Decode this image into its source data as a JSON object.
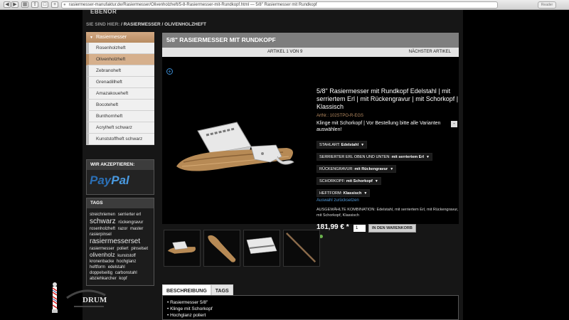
{
  "browser": {
    "url": "rasiermesser-manufaktur.de/Rasiermesser/Olivenholzheft/5-8-Rasiermesser-mit-Rundkopf.html — 5/8\" Rasiermesser mit Rundkopf",
    "reader_label": "Reader"
  },
  "page": {
    "brand_fragment": "EBENOR",
    "breadcrumb": {
      "label": "SIE SIND HIER:",
      "path": "/ RASIERMESSER / OLIVENHOLZHEFT"
    }
  },
  "sidebar": {
    "header": "Rasiermesser",
    "items": [
      {
        "label": "Rosenholzheft",
        "active": false
      },
      {
        "label": "Olivenholzheft",
        "active": true
      },
      {
        "label": "Zebranoheft",
        "active": false
      },
      {
        "label": "Grenadillheft",
        "active": false
      },
      {
        "label": "Amazakoueheft",
        "active": false
      },
      {
        "label": "Bocoteheft",
        "active": false
      },
      {
        "label": "Bunthornheft",
        "active": false
      },
      {
        "label": "Acrylheft schwarz",
        "active": false
      },
      {
        "label": "Kunststoffheft schwarz",
        "active": false
      }
    ],
    "payment_title": "WIR AKZEPTIEREN:",
    "paypal": {
      "part1": "Pay",
      "part2": "Pal"
    },
    "tags_title": "TAGS",
    "tags": [
      {
        "text": "streichriemen",
        "size": "small"
      },
      {
        "text": "serrierter erl",
        "size": "small"
      },
      {
        "text": "schwarz",
        "size": "big"
      },
      {
        "text": "rückengravur",
        "size": "small"
      },
      {
        "text": "rosenholzheft",
        "size": "small"
      },
      {
        "text": "razor",
        "size": "small"
      },
      {
        "text": "master",
        "size": "small"
      },
      {
        "text": "rasierpinsel",
        "size": "small"
      },
      {
        "text": "rasiermesserset",
        "size": "big"
      },
      {
        "text": "rasiermesser",
        "size": "small"
      },
      {
        "text": "poliert",
        "size": "small"
      },
      {
        "text": "pinselset",
        "size": "small"
      },
      {
        "text": "olivenholz",
        "size": "med"
      },
      {
        "text": "kunststoff",
        "size": "small"
      },
      {
        "text": "kronenbacke",
        "size": "small"
      },
      {
        "text": "hochglanz",
        "size": "small"
      },
      {
        "text": "heftform",
        "size": "small"
      },
      {
        "text": "edelstahl",
        "size": "small"
      },
      {
        "text": "doppelseitig",
        "size": "small"
      },
      {
        "text": "carbonstahl",
        "size": "small"
      },
      {
        "text": "abziehkarcher",
        "size": "small"
      },
      {
        "text": "kopf",
        "size": "small"
      }
    ]
  },
  "product": {
    "title_bar": "5/8\" RASIERMESSER MIT RUNDKOPF",
    "article_counter": "ARTIKEL 1 VON 9",
    "next_label": "NÄCHSTER ARTIKEL",
    "name": "5/8\" Rasiermesser mit Rundkopf Edelstahl | mit serriertem Erl | mit Rückengravur | mit Schorkopf | Klassisch",
    "art_nr": "ArtNr.: 102STPO-R-EGS",
    "description": "Klinge mit Schorkopf | Vor Bestellung bitte alle Varianten auswählen!",
    "options": [
      {
        "label": "STAHLART:",
        "value": "Edelstahl"
      },
      {
        "label": "SERRIERTER ERL OBEN UND UNTEN:",
        "value": "mit serriertem Erl"
      },
      {
        "label": "RÜCKENGRAVUR:",
        "value": "mit Rückengravur"
      },
      {
        "label": "SCHORKOPF:",
        "value": "mit Schorkopf"
      },
      {
        "label": "HEFTFORM:",
        "value": "Klassisch"
      }
    ],
    "reset_link": "Auswahl zurücksetzen",
    "combination": "AUSGEWÄHLTE KOMBINATION: Edelstahl, mit serriertem Erl, mit Rückengravur, mit Schorkopf, Klassisch",
    "price": "181,99 € *",
    "quantity": "1",
    "cart_button": "IN DEN WARENKORB"
  },
  "tabs": [
    {
      "label": "BESCHREIBUNG",
      "active": true
    },
    {
      "label": "TAGS",
      "active": false
    }
  ],
  "description_bullets": [
    "• Rasiermesser 5/8\"",
    "• Klinge mit Schorkopf",
    "• Hochglanz poliert"
  ],
  "logo_text": "DRUM",
  "colors": {
    "accent": "#b88c62",
    "link": "#4f98d8",
    "title_bar": "#7e7e7e"
  }
}
